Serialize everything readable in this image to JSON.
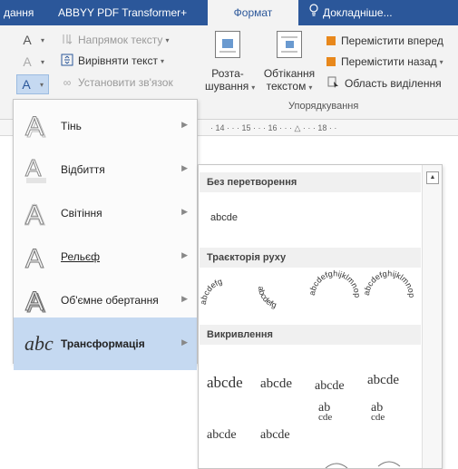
{
  "tabs": [
    "дання",
    "ABBYY PDF Transformer+",
    "Формат",
    "Докладніше..."
  ],
  "ribbon": {
    "text_direction": "Напрямок тексту",
    "align_text": "Вирівняти текст",
    "create_link": "Установити зв'язок",
    "position_label_1": "Розта-",
    "position_label_2": "шування",
    "wrap_label_1": "Обтікання",
    "wrap_label_2": "текстом",
    "bring_forward": "Перемістити вперед",
    "send_backward": "Перемістити назад",
    "selection_pane": "Область виділення",
    "arrange_group": "Упорядкування"
  },
  "ruler_text": "· 14 · · · 15 · · · 16 · · · △ · · · 18 · ·",
  "effects_menu": [
    {
      "label": "Тінь",
      "icon": "shadow-a-icon"
    },
    {
      "label": "Відбиття",
      "icon": "reflection-a-icon"
    },
    {
      "label": "Світіння",
      "icon": "glow-a-icon"
    },
    {
      "label": "Рельєф",
      "icon": "bevel-a-icon"
    },
    {
      "label": "Об'ємне обертання",
      "icon": "3d-rotation-a-icon"
    },
    {
      "label": "Трансформація",
      "icon": "abc-transform-icon"
    }
  ],
  "gallery": {
    "no_transform": "Без перетворення",
    "plain_sample": "abcde",
    "follow_path": "Траєкторія руху",
    "warp": "Викривлення",
    "path_samples": [
      "abcdefg",
      "abcdefg",
      "abcdefghijklmnop",
      "abcdefghijklmnop"
    ],
    "warp_row1": [
      "abcde",
      "abcde",
      "abcde",
      "abcde"
    ],
    "warp_row2": [
      "abcde",
      "abcde",
      "ab",
      "ab"
    ],
    "warp_row2b": [
      "",
      "",
      "cde",
      "cde"
    ],
    "warp_row3": [
      "",
      "",
      "",
      ""
    ]
  },
  "colors": {
    "accent": "#2b579a",
    "highlight": "#c5d9f1",
    "orange": "#e8881c"
  }
}
